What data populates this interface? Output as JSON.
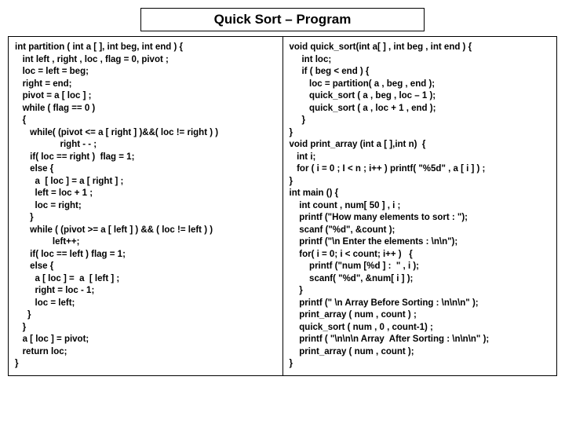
{
  "title": "Quick Sort – Program",
  "left_code": "int partition ( int a [ ], int beg, int end ) {\n   int left , right , loc , flag = 0, pivot ;\n   loc = left = beg;\n   right = end;\n   pivot = a [ loc ] ;\n   while ( flag == 0 )\n   {\n      while( (pivot <= a [ right ] )&&( loc != right ) )\n                  right - - ;\n      if( loc == right )  flag = 1;\n      else {\n        a  [ loc ] = a [ right ] ;\n        left = loc + 1 ;\n        loc = right;\n      }\n      while ( (pivot >= a [ left ] ) && ( loc != left ) )\n               left++;\n      if( loc == left ) flag = 1;\n      else {\n        a [ loc ] =  a  [ left ] ;\n        right = loc - 1;\n        loc = left;\n     }\n   }\n   a [ loc ] = pivot;\n   return loc;\n}",
  "right_code": "void quick_sort(int a[ ] , int beg , int end ) {\n     int loc;\n     if ( beg < end ) {\n        loc = partition( a , beg , end );\n        quick_sort ( a , beg , loc – 1 );\n        quick_sort ( a , loc + 1 , end );\n     }\n}\nvoid print_array (int a [ ],int n)  {\n   int i;\n   for ( i = 0 ; I < n ; i++ ) printf( \"%5d\" , a [ i ] ) ;\n}\nint main () {\n    int count , num[ 50 ] , i ;\n    printf (\"How many elements to sort : \");\n    scanf (\"%d\", &count );\n    printf (\"\\n Enter the elements : \\n\\n\");\n    for( i = 0; i < count; i++ )   {\n        printf (\"num [%d ] :  \" , i );\n        scanf( \"%d\", &num[ i ] );\n    }\n    printf (\" \\n Array Before Sorting : \\n\\n\\n\" );\n    print_array ( num , count ) ;\n    quick_sort ( num , 0 , count-1) ;\n    printf ( \"\\n\\n\\n Array  After Sorting : \\n\\n\\n\" );\n    print_array ( num , count );\n}"
}
